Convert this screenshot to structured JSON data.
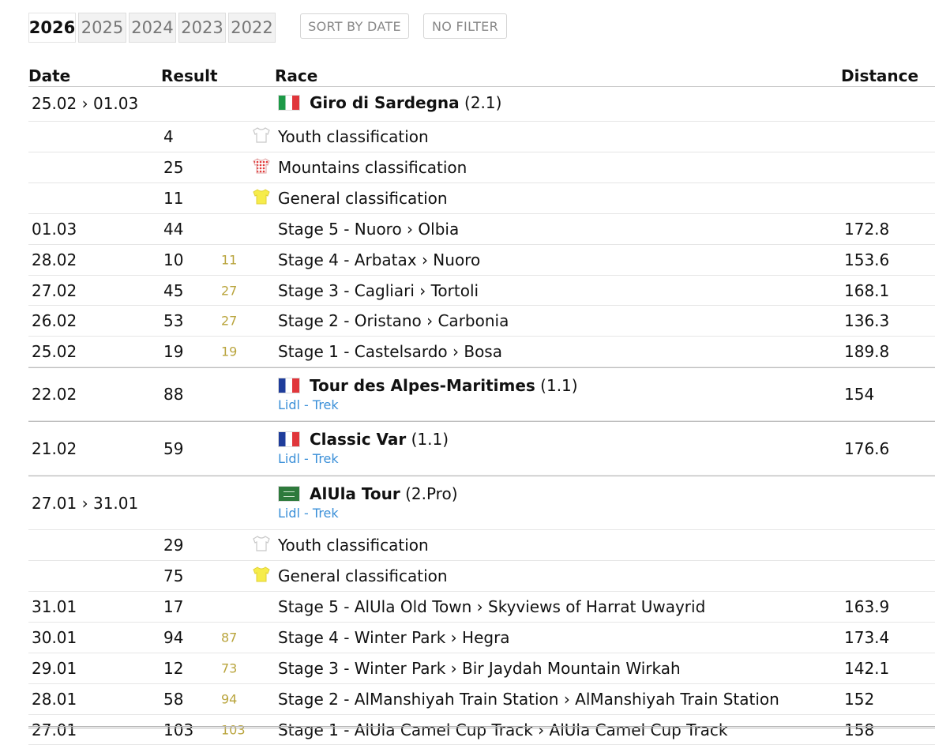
{
  "years": [
    "2026",
    "2025",
    "2024",
    "2023",
    "2022"
  ],
  "active_year": "2026",
  "buttons": {
    "sort": "SORT BY DATE",
    "filter": "NO FILTER"
  },
  "columns": {
    "date": "Date",
    "result": "Result",
    "race": "Race",
    "distance": "Distance"
  },
  "rows": [
    {
      "kind": "race",
      "date": "25.02 › 01.03",
      "result": "",
      "gc": "",
      "flag": "it",
      "race": "Giro di Sardegna",
      "class": "(2.1)",
      "team": "",
      "distance": ""
    },
    {
      "kind": "cls",
      "date": "",
      "result": "4",
      "gc": "",
      "jersey": "white",
      "race": "Youth classification",
      "distance": ""
    },
    {
      "kind": "cls",
      "date": "",
      "result": "25",
      "gc": "",
      "jersey": "polka",
      "race": "Mountains classification",
      "distance": ""
    },
    {
      "kind": "cls",
      "date": "",
      "result": "11",
      "gc": "",
      "jersey": "yellow",
      "race": "General classification",
      "distance": ""
    },
    {
      "kind": "stage",
      "date": "01.03",
      "result": "44",
      "gc": "",
      "race": "Stage 5 - Nuoro › Olbia",
      "distance": "172.8"
    },
    {
      "kind": "stage",
      "date": "28.02",
      "result": "10",
      "gc": "11",
      "race": "Stage 4 - Arbatax › Nuoro",
      "distance": "153.6"
    },
    {
      "kind": "stage",
      "date": "27.02",
      "result": "45",
      "gc": "27",
      "race": "Stage 3 - Cagliari › Tortoli",
      "distance": "168.1"
    },
    {
      "kind": "stage",
      "date": "26.02",
      "result": "53",
      "gc": "27",
      "race": "Stage 2 - Oristano › Carbonia",
      "distance": "136.3"
    },
    {
      "kind": "stage",
      "date": "25.02",
      "result": "19",
      "gc": "19",
      "race": "Stage 1 - Castelsardo › Bosa",
      "distance": "189.8"
    },
    {
      "kind": "oneday",
      "date": "22.02",
      "result": "88",
      "gc": "",
      "flag": "fr",
      "race": "Tour des Alpes-Maritimes",
      "class": "(1.1)",
      "team": "Lidl - Trek",
      "distance": "154"
    },
    {
      "kind": "oneday",
      "date": "21.02",
      "result": "59",
      "gc": "",
      "flag": "fr",
      "race": "Classic Var",
      "class": "(1.1)",
      "team": "Lidl - Trek",
      "distance": "176.6"
    },
    {
      "kind": "oneday",
      "date": "27.01 › 31.01",
      "result": "",
      "gc": "",
      "flag": "sa",
      "race": "AlUla Tour",
      "class": "(2.Pro)",
      "team": "Lidl - Trek",
      "distance": ""
    },
    {
      "kind": "cls",
      "date": "",
      "result": "29",
      "gc": "",
      "jersey": "white",
      "race": "Youth classification",
      "distance": ""
    },
    {
      "kind": "cls",
      "date": "",
      "result": "75",
      "gc": "",
      "jersey": "yellow",
      "race": "General classification",
      "distance": ""
    },
    {
      "kind": "stage",
      "date": "31.01",
      "result": "17",
      "gc": "",
      "race": "Stage 5 - AlUla Old Town › Skyviews of Harrat Uwayrid",
      "distance": "163.9"
    },
    {
      "kind": "stage",
      "date": "30.01",
      "result": "94",
      "gc": "87",
      "race": "Stage 4 - Winter Park › Hegra",
      "distance": "173.4"
    },
    {
      "kind": "stage",
      "date": "29.01",
      "result": "12",
      "gc": "73",
      "race": "Stage 3 - Winter Park › Bir Jaydah Mountain Wirkah",
      "distance": "142.1"
    },
    {
      "kind": "stage",
      "date": "28.01",
      "result": "58",
      "gc": "94",
      "race": "Stage 2 - AlManshiyah Train Station › AlManshiyah Train Station",
      "distance": "152"
    },
    {
      "kind": "stage",
      "date": "27.01",
      "result": "103",
      "gc": "103",
      "race": "Stage 1 - AlUla Camel Cup Track › AlUla Camel Cup Track",
      "distance": "158"
    }
  ]
}
